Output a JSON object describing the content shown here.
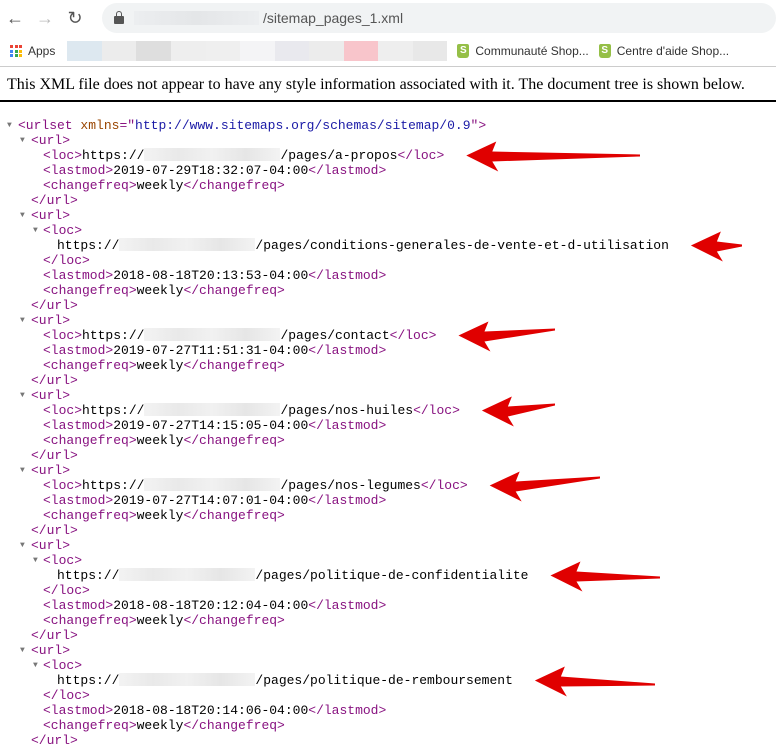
{
  "browser": {
    "url": "/sitemap_pages_1.xml",
    "bookmarks": {
      "apps": "Apps",
      "items": [
        "Communauté Shop...",
        "Centre d'aide Shop..."
      ]
    }
  },
  "info_message": "This XML file does not appear to have any style information associated with it. The document tree is shown below.",
  "xml": {
    "root_tag": "urlset",
    "root_attr_name": "xmlns",
    "root_attr_value": "http://www.sitemaps.org/schemas/sitemap/0.9",
    "loc_prefix": "https://",
    "urls": [
      {
        "path": "/pages/a-propos",
        "lastmod": "2019-07-29T18:32:07-04:00",
        "changefreq": "weekly",
        "expanded": false
      },
      {
        "path": "/pages/conditions-generales-de-vente-et-d-utilisation",
        "lastmod": "2018-08-18T20:13:53-04:00",
        "changefreq": "weekly",
        "expanded": true
      },
      {
        "path": "/pages/contact",
        "lastmod": "2019-07-27T11:51:31-04:00",
        "changefreq": "weekly",
        "expanded": false
      },
      {
        "path": "/pages/nos-huiles",
        "lastmod": "2019-07-27T14:15:05-04:00",
        "changefreq": "weekly",
        "expanded": false
      },
      {
        "path": "/pages/nos-legumes",
        "lastmod": "2019-07-27T14:07:01-04:00",
        "changefreq": "weekly",
        "expanded": false
      },
      {
        "path": "/pages/politique-de-confidentialite",
        "lastmod": "2018-08-18T20:12:04-04:00",
        "changefreq": "weekly",
        "expanded": true
      },
      {
        "path": "/pages/politique-de-remboursement",
        "lastmod": "2018-08-18T20:14:06-04:00",
        "changefreq": "weekly",
        "expanded": true
      }
    ]
  },
  "colors": {
    "tag": "#881280",
    "attr_name": "#994500",
    "attr_value": "#1a1aa6",
    "arrow": "#e00000"
  }
}
